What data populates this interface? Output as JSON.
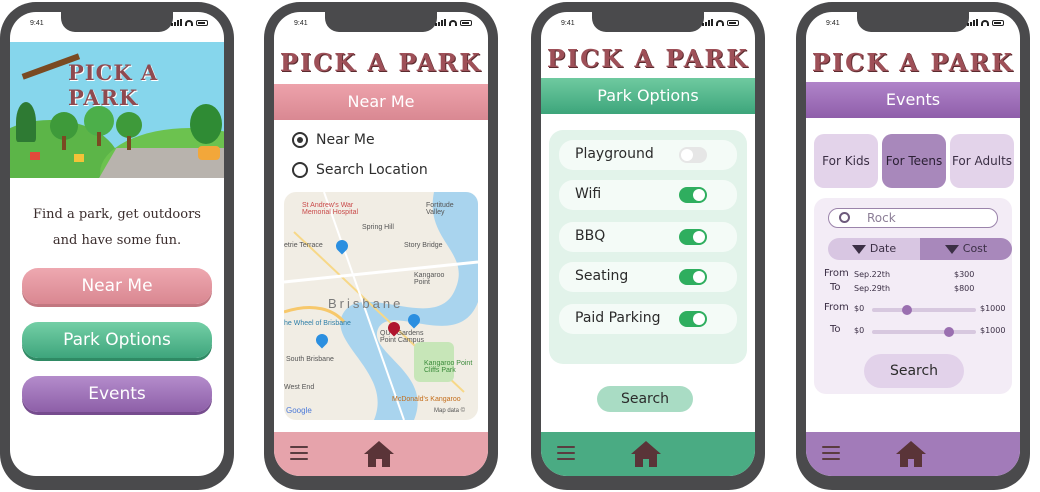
{
  "status": {
    "time": "9:41"
  },
  "app": {
    "title": "PICK A PARK"
  },
  "phone1": {
    "tagline_line1": "Find a park, get outdoors",
    "tagline_line2": "and have some fun.",
    "buttons": [
      "Near Me",
      "Park Options",
      "Events"
    ]
  },
  "phone2": {
    "header": "Near Me",
    "radio_near": "Near Me",
    "radio_search": "Search Location",
    "map_labels": {
      "hospital": "St Andrew's War Memorial Hospital",
      "spring_hill": "Spring Hill",
      "fortitude": "Fortitude Valley",
      "story_bridge": "Story Bridge",
      "terrace": "etrie Terrace",
      "kangaroo_point": "Kangaroo Point",
      "city": "Brisbane",
      "wheel": "he Wheel of Brisbane",
      "campus": "QUT Gardens Point Campus",
      "south": "South Brisbane",
      "cliffs": "Kangaroo Point Cliffs Park",
      "west_end": "West End",
      "mcd": "McDonald's Kangaroo",
      "google": "Google",
      "mapdata": "Map data ©"
    }
  },
  "phone3": {
    "header": "Park Options",
    "options": [
      {
        "label": "Playground",
        "on": false
      },
      {
        "label": "Wifi",
        "on": true
      },
      {
        "label": "BBQ",
        "on": true
      },
      {
        "label": "Seating",
        "on": true
      },
      {
        "label": "Paid Parking",
        "on": true
      }
    ],
    "search": "Search"
  },
  "phone4": {
    "header": "Events",
    "segments": [
      "For Kids",
      "For Teens",
      "For Adults"
    ],
    "search_value": "Rock",
    "sort_date": "Date",
    "sort_cost": "Cost",
    "from_label": "From",
    "to_label": "To",
    "from_date": "Sep.22th",
    "to_date": "Sep.29th",
    "cost_from": "$300",
    "cost_to": "$800",
    "range_min": "$0",
    "range_max": "$1000",
    "search": "Search"
  },
  "colors": {
    "rose": "#e39aa3",
    "green": "#3fae86",
    "purple": "#9d72b6"
  }
}
